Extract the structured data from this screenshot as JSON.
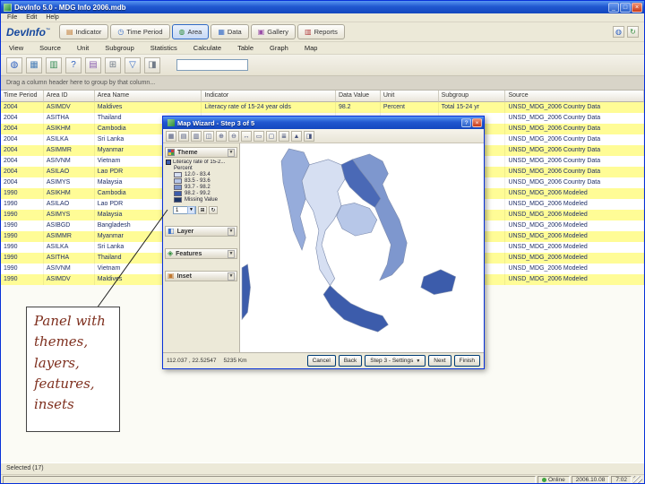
{
  "window": {
    "title": "DevInfo 5.0 - MDG Info 2006.mdb",
    "menu": [
      "File",
      "Edit",
      "Help"
    ]
  },
  "brand": {
    "name": "DevInfo",
    "tm": "™"
  },
  "tabs": [
    {
      "name": "tab-indicator",
      "label": "Indicator",
      "glyph": "▤",
      "color": "#C07830",
      "active": false
    },
    {
      "name": "tab-time-period",
      "label": "Time Period",
      "glyph": "◷",
      "color": "#3A6FC8",
      "active": false
    },
    {
      "name": "tab-area",
      "label": "Area",
      "glyph": "◍",
      "color": "#2E8B3A",
      "active": true
    },
    {
      "name": "tab-data",
      "label": "Data",
      "glyph": "▦",
      "color": "#3A6FC8",
      "active": false
    },
    {
      "name": "tab-gallery",
      "label": "Gallery",
      "glyph": "▣",
      "color": "#9A4FA8",
      "active": false
    },
    {
      "name": "tab-reports",
      "label": "Reports",
      "glyph": "▥",
      "color": "#B03A3A",
      "active": false
    }
  ],
  "header_icons": [
    {
      "name": "globe-icon",
      "glyph": "◍",
      "color": "#2B5FC0"
    },
    {
      "name": "refresh-icon",
      "glyph": "↻",
      "color": "#2E8B3A"
    }
  ],
  "menu2": [
    {
      "name": "menu-view",
      "label": "View"
    },
    {
      "name": "menu-source",
      "label": "Source"
    },
    {
      "name": "menu-unit",
      "label": "Unit"
    },
    {
      "name": "menu-subgroup",
      "label": "Subgroup"
    },
    {
      "name": "menu-statistics",
      "label": "Statistics"
    },
    {
      "name": "menu-calculate",
      "label": "Calculate"
    },
    {
      "name": "menu-table",
      "label": "Table"
    },
    {
      "name": "menu-graph",
      "label": "Graph"
    },
    {
      "name": "menu-map",
      "label": "Map"
    }
  ],
  "toolbar": {
    "icons": [
      {
        "name": "map-icon",
        "glyph": "◍",
        "color": "#2B5FC0"
      },
      {
        "name": "table-icon",
        "glyph": "▦",
        "color": "#4A7FB8"
      },
      {
        "name": "graph-icon",
        "glyph": "▥",
        "color": "#3A8F5A"
      },
      {
        "name": "help-icon",
        "glyph": "?",
        "color": "#2B5FC0"
      },
      {
        "name": "gallery-icon",
        "glyph": "▤",
        "color": "#8A5FB0"
      },
      {
        "name": "calculator-icon",
        "glyph": "⊞",
        "color": "#707A88"
      },
      {
        "name": "filter-icon",
        "glyph": "▽",
        "color": "#3A6FC8"
      },
      {
        "name": "settings-icon",
        "glyph": "◨",
        "color": "#707A88"
      }
    ],
    "search_value": ""
  },
  "group_bar": "Drag a column header here to group by that column...",
  "table": {
    "columns": [
      "Time Period",
      "Area ID",
      "Area Name",
      "Indicator",
      "Data Value",
      "Unit",
      "Subgroup",
      "Source"
    ],
    "rows": [
      {
        "tp": "2004",
        "id": "ASIMDV",
        "name": "Maldives",
        "ind": "Literacy rate of 15-24 year olds",
        "val": "98.2",
        "unit": "Percent",
        "sub": "Total 15-24 yr",
        "src": "UNSD_MDG_2006 Country Data"
      },
      {
        "tp": "2004",
        "id": "ASITHA",
        "name": "Thailand",
        "src": "UNSD_MDG_2006 Country Data"
      },
      {
        "tp": "2004",
        "id": "ASIKHM",
        "name": "Cambodia",
        "src": "UNSD_MDG_2006 Country Data"
      },
      {
        "tp": "2004",
        "id": "ASILKA",
        "name": "Sri Lanka",
        "src": "UNSD_MDG_2006 Country Data"
      },
      {
        "tp": "2004",
        "id": "ASIMMR",
        "name": "Myanmar",
        "src": "UNSD_MDG_2006 Country Data"
      },
      {
        "tp": "2004",
        "id": "ASIVNM",
        "name": "Vietnam",
        "src": "UNSD_MDG_2006 Country Data"
      },
      {
        "tp": "2004",
        "id": "ASILAO",
        "name": "Lao PDR",
        "src": "UNSD_MDG_2006 Country Data"
      },
      {
        "tp": "2004",
        "id": "ASIMYS",
        "name": "Malaysia",
        "src": "UNSD_MDG_2006 Country Data"
      },
      {
        "tp": "1990",
        "id": "ASIKHM",
        "name": "Cambodia",
        "src": "UNSD_MDG_2006 Modeled"
      },
      {
        "tp": "1990",
        "id": "ASILAO",
        "name": "Lao PDR",
        "src": "UNSD_MDG_2006 Modeled"
      },
      {
        "tp": "1990",
        "id": "ASIMYS",
        "name": "Malaysia",
        "src": "UNSD_MDG_2006 Modeled"
      },
      {
        "tp": "1990",
        "id": "ASIBGD",
        "name": "Bangladesh",
        "src": "UNSD_MDG_2006 Modeled"
      },
      {
        "tp": "1990",
        "id": "ASIMMR",
        "name": "Myanmar",
        "src": "UNSD_MDG_2006 Modeled"
      },
      {
        "tp": "1990",
        "id": "ASILKA",
        "name": "Sri Lanka",
        "src": "UNSD_MDG_2006 Modeled"
      },
      {
        "tp": "1990",
        "id": "ASITHA",
        "name": "Thailand",
        "src": "UNSD_MDG_2006 Modeled"
      },
      {
        "tp": "1990",
        "id": "ASIVNM",
        "name": "Vietnam",
        "src": "UNSD_MDG_2006 Modeled"
      },
      {
        "tp": "1990",
        "id": "ASIMDV",
        "name": "Maldives",
        "src": "UNSD_MDG_2006 Modeled"
      }
    ]
  },
  "wizard": {
    "title": "Map Wizard - Step 3 of 5",
    "toolbar_icons": [
      {
        "name": "save-icon",
        "glyph": "▦"
      },
      {
        "name": "export-icon",
        "glyph": "▤"
      },
      {
        "name": "print-icon",
        "glyph": "▥"
      },
      {
        "name": "copy-icon",
        "glyph": "◫"
      },
      {
        "name": "zoom-in-icon",
        "glyph": "⊕"
      },
      {
        "name": "zoom-out-icon",
        "glyph": "⊖"
      },
      {
        "name": "pan-icon",
        "glyph": "↔"
      },
      {
        "name": "full-extent-icon",
        "glyph": "▭"
      },
      {
        "name": "select-icon",
        "glyph": "▢"
      },
      {
        "name": "legend-icon",
        "glyph": "≣"
      },
      {
        "name": "north-arrow-icon",
        "glyph": "▲"
      },
      {
        "name": "settings-icon",
        "glyph": "◨"
      }
    ],
    "panel": {
      "theme": {
        "label": "Theme",
        "indicator": "Literacy rate of 15-2...",
        "unit": "Percent",
        "legend": [
          {
            "range": "12.0 - 83.4",
            "color": "#D6DFF2"
          },
          {
            "range": "83.5 - 93.6",
            "color": "#B7C7E8"
          },
          {
            "range": "93.7 - 98.2",
            "color": "#7E97CE"
          },
          {
            "range": "98.2 - 99.2",
            "color": "#3C5CAB"
          },
          {
            "range": "Missing Value",
            "color": "#1B3568"
          }
        ],
        "breaks_value": "1"
      },
      "sections": [
        {
          "name": "section-layer",
          "label": "Layer",
          "glyph": "◧",
          "color": "#3A6FC8"
        },
        {
          "name": "section-features",
          "label": "Features",
          "glyph": "◈",
          "color": "#2E8B3A"
        },
        {
          "name": "section-inset",
          "label": "Inset",
          "glyph": "▣",
          "color": "#C07830"
        }
      ]
    },
    "map": {
      "regions": {
        "myanmar": "#96ACDB",
        "thailand": "#D6DFF2",
        "laos": "#4A69B6",
        "vietnam": "#7E97CE",
        "cambodia": "#B7C7E8",
        "malaysia": "#3C5CAB",
        "borneo": "#3C5CAB",
        "island": "#3C5CAB"
      }
    },
    "coords": "112.037 , 22.52547",
    "scale": "5235 Km",
    "buttons": {
      "cancel": "Cancel",
      "back": "Back",
      "step": "Step 3 - Settings",
      "next": "Next",
      "finish": "Finish"
    }
  },
  "callout": {
    "text": "Panel with themes, layers, features, insets"
  },
  "status": {
    "selected": "Selected (17)",
    "online": "Online",
    "date": "2006.10.08",
    "time": "7:02"
  }
}
